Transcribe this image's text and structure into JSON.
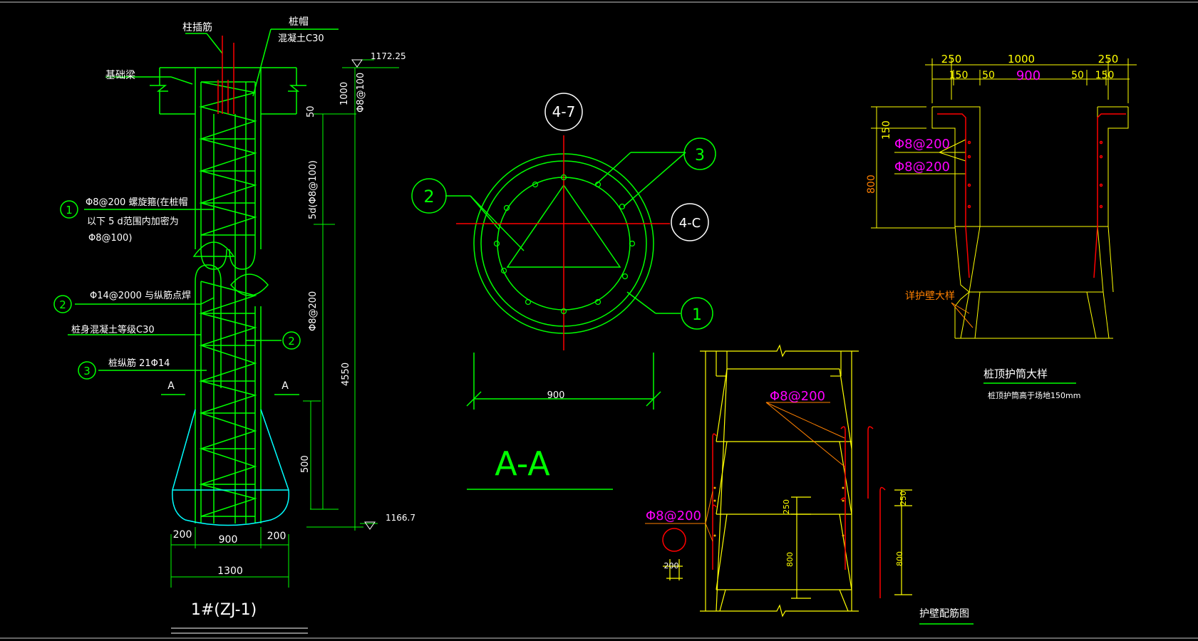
{
  "colors": {
    "background": "#000000",
    "main": "#00FF00",
    "text": "#FFFFFF",
    "rebar": "#FF0000",
    "magenta": "#FF00FF",
    "yellow": "#FFFF00",
    "cyan": "#00FFFF",
    "orange": "#FF8000"
  },
  "pile_section": {
    "labels": {
      "col_rebar": "柱插筋",
      "cap": "桩帽",
      "cap_concrete": "混凝土C30",
      "foundation_beam": "基础梁",
      "top_elev": "1172.25",
      "bottom_elev": "1166.7",
      "dim_1000": "1000",
      "rebar_top": "Φ8@100",
      "dim_50": "50",
      "dim_5d": "5d(Φ8@100)",
      "rebar_mid": "Φ8@200",
      "dim_4550": "4550",
      "dim_500": "500",
      "callout_1": "1",
      "callout_1_text_a": "Φ8@200   螺旋箍(在桩帽",
      "callout_1_text_b": "以下  5 d范围内加密为",
      "callout_1_text_c": "Φ8@100)",
      "callout_2": "2",
      "callout_2_text": "Φ14@2000   与纵筋点焊",
      "concrete_grade": "桩身混凝土等级C30",
      "callout_3": "3",
      "callout_3_text": "桩纵筋    21Φ14",
      "section_a_left": "A",
      "section_a_right": "A",
      "dim_200_left": "200",
      "dim_900": "900",
      "dim_200_right": "200",
      "dim_1300": "1300",
      "title": "1#(ZJ-1)"
    }
  },
  "section_aa": {
    "labels": {
      "axis_top": "4-7",
      "axis_right": "4-C",
      "callout_1": "1",
      "callout_2": "2",
      "callout_3": "3",
      "dim_900": "900",
      "title": "A-A"
    }
  },
  "casing_detail": {
    "labels": {
      "dim_250_left": "250",
      "dim_1000": "1000",
      "dim_250_right": "250",
      "dim_150_left": "150",
      "dim_50_left": "50",
      "dim_900": "900",
      "dim_50_right": "50",
      "dim_150_right": "150",
      "dim_150_v": "150",
      "dim_800_v": "800",
      "rebar_a": "Φ8@200",
      "rebar_b": "Φ8@200",
      "wall_detail": "详护壁大样",
      "title": "桩顶护筒大样",
      "note": "桩顶护筒高于场地150mm"
    }
  },
  "wall_rebar": {
    "labels": {
      "rebar_top": "Φ8@200",
      "rebar_left": "Φ8@200",
      "dim_200": "200",
      "dim_250_inner": "250",
      "dim_800_inner": "800",
      "dim_250_right": "250",
      "dim_800_right": "800",
      "title": "护壁配筋图"
    }
  }
}
